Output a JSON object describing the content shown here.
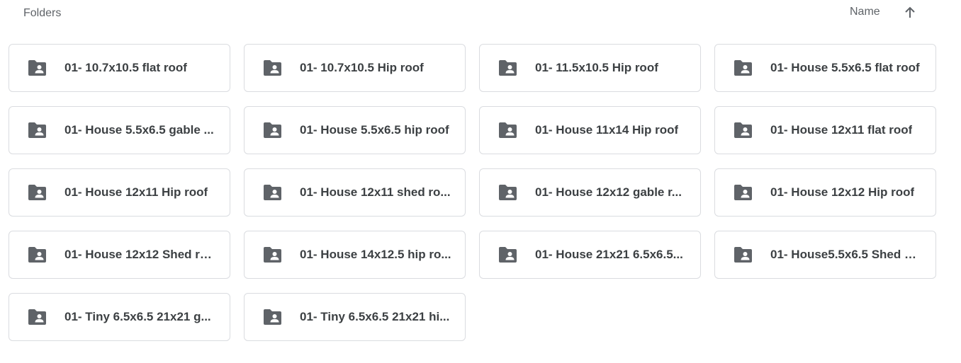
{
  "section": {
    "title": "Folders"
  },
  "sort": {
    "label": "Name",
    "direction_icon": "arrow-up-icon"
  },
  "folders": [
    {
      "name": "01- 10.7x10.5 flat roof",
      "icon": "shared-folder-icon"
    },
    {
      "name": "01- 10.7x10.5 Hip roof",
      "icon": "shared-folder-icon"
    },
    {
      "name": "01- 11.5x10.5 Hip roof",
      "icon": "shared-folder-icon"
    },
    {
      "name": "01- House 5.5x6.5 flat roof",
      "icon": "shared-folder-icon"
    },
    {
      "name": "01- House 5.5x6.5 gable ...",
      "icon": "shared-folder-icon"
    },
    {
      "name": "01- House 5.5x6.5 hip roof",
      "icon": "shared-folder-icon"
    },
    {
      "name": "01- House 11x14 Hip roof",
      "icon": "shared-folder-icon"
    },
    {
      "name": "01- House 12x11 flat roof",
      "icon": "shared-folder-icon"
    },
    {
      "name": "01- House 12x11 Hip roof",
      "icon": "shared-folder-icon"
    },
    {
      "name": "01- House 12x11 shed ro...",
      "icon": "shared-folder-icon"
    },
    {
      "name": "01- House 12x12 gable r...",
      "icon": "shared-folder-icon"
    },
    {
      "name": "01- House 12x12 Hip roof",
      "icon": "shared-folder-icon"
    },
    {
      "name": "01- House 12x12 Shed ro...",
      "icon": "shared-folder-icon"
    },
    {
      "name": "01- House 14x12.5 hip ro...",
      "icon": "shared-folder-icon"
    },
    {
      "name": "01- House 21x21 6.5x6.5...",
      "icon": "shared-folder-icon"
    },
    {
      "name": "01- House5.5x6.5 Shed R...",
      "icon": "shared-folder-icon"
    },
    {
      "name": "01- Tiny 6.5x6.5 21x21 g...",
      "icon": "shared-folder-icon"
    },
    {
      "name": "01- Tiny 6.5x6.5 21x21 hi...",
      "icon": "shared-folder-icon"
    }
  ],
  "colors": {
    "icon": "#5f6368",
    "border": "#dadce0",
    "text": "#3c4043"
  }
}
